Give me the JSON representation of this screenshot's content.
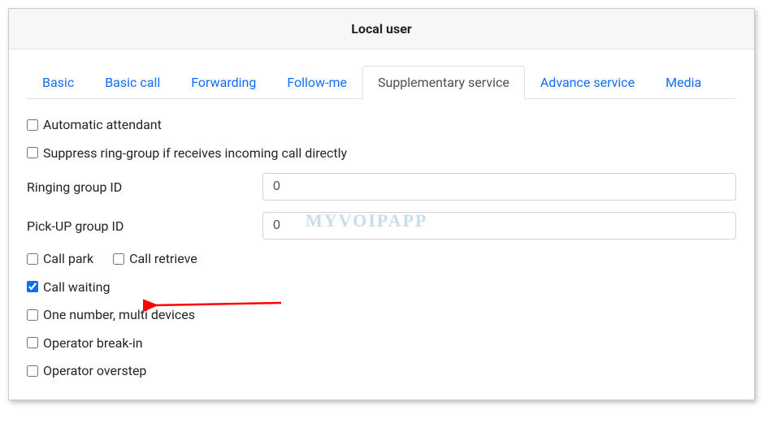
{
  "header": {
    "title": "Local user"
  },
  "tabs": {
    "items": [
      {
        "label": "Basic"
      },
      {
        "label": "Basic call"
      },
      {
        "label": "Forwarding"
      },
      {
        "label": "Follow-me"
      },
      {
        "label": "Supplementary service"
      },
      {
        "label": "Advance service"
      },
      {
        "label": "Media"
      }
    ],
    "active_index": 4
  },
  "options": {
    "automatic_attendant": {
      "label": "Automatic attendant",
      "checked": false
    },
    "suppress_ring_group": {
      "label": "Suppress ring-group if receives incoming call directly",
      "checked": false
    },
    "call_park": {
      "label": "Call park",
      "checked": false
    },
    "call_retrieve": {
      "label": "Call retrieve",
      "checked": false
    },
    "call_waiting": {
      "label": "Call waiting",
      "checked": true
    },
    "one_number_multi": {
      "label": "One number, multi devices",
      "checked": false
    },
    "operator_break_in": {
      "label": "Operator break-in",
      "checked": false
    },
    "operator_overstep": {
      "label": "Operator overstep",
      "checked": false
    }
  },
  "fields": {
    "ringing_group_id": {
      "label": "Ringing group ID",
      "value": "0"
    },
    "pickup_group_id": {
      "label": "Pick-UP group ID",
      "value": "0"
    }
  },
  "watermark": "MYVOIPAPP",
  "annotation": {
    "arrow_color": "#ff0000"
  }
}
